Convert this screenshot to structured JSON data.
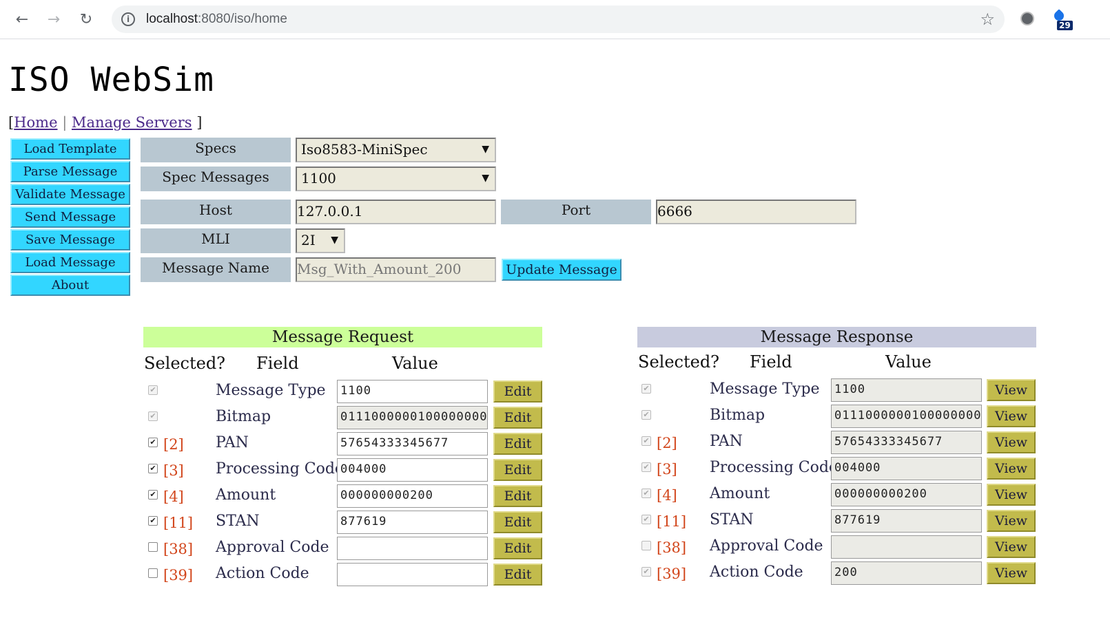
{
  "browser": {
    "url_host": "localhost",
    "url_path": ":8080/iso/home",
    "ext_badge": "29"
  },
  "app": {
    "title": "ISO WebSim",
    "nav": {
      "open": "[",
      "home": "Home",
      "sep": "|",
      "manage": "Manage Servers",
      "close": "]"
    }
  },
  "sidebar": {
    "items": [
      "Load Template",
      "Parse Message",
      "Validate Message",
      "Send Message",
      "Save Message",
      "Load Message",
      "About"
    ]
  },
  "form": {
    "specs_label": "Specs",
    "specs_value": "Iso8583-MiniSpec",
    "spec_messages_label": "Spec Messages",
    "spec_messages_value": "1100",
    "host_label": "Host",
    "host_value": "127.0.0.1",
    "port_label": "Port",
    "port_value": "6666",
    "mli_label": "MLI",
    "mli_value": "2I",
    "message_name_label": "Message Name",
    "message_name_placeholder": "Msg_With_Amount_200",
    "update_button": "Update Message"
  },
  "request": {
    "title": "Message Request",
    "col_selected": "Selected?",
    "col_field": "Field",
    "col_value": "Value",
    "action_label": "Edit",
    "rows": [
      {
        "num": "",
        "name": "Message Type",
        "value": "1100",
        "checked": true,
        "disabled": true
      },
      {
        "num": "",
        "name": "Bitmap",
        "value": "0111000000100000000",
        "checked": true,
        "disabled": true
      },
      {
        "num": "[2]",
        "name": "PAN",
        "value": "57654333345677",
        "checked": true,
        "disabled": false
      },
      {
        "num": "[3]",
        "name": "Processing Code",
        "value": "004000",
        "checked": true,
        "disabled": false
      },
      {
        "num": "[4]",
        "name": "Amount",
        "value": "000000000200",
        "checked": true,
        "disabled": false
      },
      {
        "num": "[11]",
        "name": "STAN",
        "value": "877619",
        "checked": true,
        "disabled": false
      },
      {
        "num": "[38]",
        "name": "Approval Code",
        "value": "",
        "checked": false,
        "disabled": false
      },
      {
        "num": "[39]",
        "name": "Action Code",
        "value": "",
        "checked": false,
        "disabled": false
      }
    ]
  },
  "response": {
    "title": "Message Response",
    "col_selected": "Selected?",
    "col_field": "Field",
    "col_value": "Value",
    "action_label": "View",
    "rows": [
      {
        "num": "",
        "name": "Message Type",
        "value": "1100",
        "checked": true
      },
      {
        "num": "",
        "name": "Bitmap",
        "value": "0111000000100000000",
        "checked": true
      },
      {
        "num": "[2]",
        "name": "PAN",
        "value": "57654333345677",
        "checked": true
      },
      {
        "num": "[3]",
        "name": "Processing Code",
        "value": "004000",
        "checked": true
      },
      {
        "num": "[4]",
        "name": "Amount",
        "value": "000000000200",
        "checked": true
      },
      {
        "num": "[11]",
        "name": "STAN",
        "value": "877619",
        "checked": true
      },
      {
        "num": "[38]",
        "name": "Approval Code",
        "value": "",
        "checked": false
      },
      {
        "num": "[39]",
        "name": "Action Code",
        "value": "200",
        "checked": true
      }
    ]
  },
  "colors": {
    "button_cyan": "#32d6ff",
    "label_gray": "#b8c7d1",
    "request_header": "#ccff99",
    "response_header": "#c8cbde",
    "action_olive": "#c2bb4c",
    "field_num": "#d2461c"
  }
}
